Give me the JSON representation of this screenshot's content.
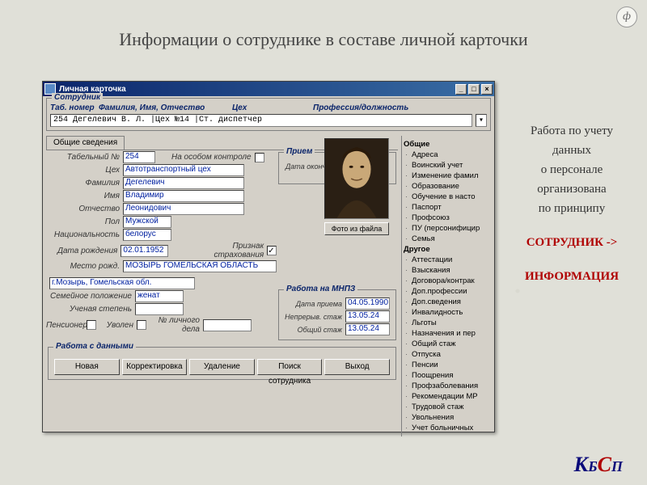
{
  "slide": {
    "title": "Информации о сотруднике в составе личной карточки",
    "side_lines": [
      "Работа по учету",
      "данных",
      "о персонале",
      "организована",
      "по принципу"
    ],
    "side_red1": "СОТРУДНИК ->",
    "side_red2": "ИНФОРМАЦИЯ",
    "brand_k": "К",
    "brand_b": "Б",
    "brand_c": "С",
    "brand_p": "П",
    "logo": "ф"
  },
  "win": {
    "title": "Личная карточка",
    "min": "_",
    "max": "□",
    "close": "×",
    "group_legend": "Сотрудник",
    "hdr_tab": "Таб. номер",
    "hdr_fio": "Фамилия, Имя, Отчество",
    "hdr_ceh": "Цех",
    "hdr_prof": "Профессия/должность",
    "hdr_line": "254    Дегелевич В. Л.          |Цех №14        |Ст. диспетчер",
    "dd": "▾",
    "tab_main": "Общие сведения",
    "lbl_tabno": "Табельный №",
    "val_tabno": "254",
    "lbl_special": "На особом контроле",
    "grp_priem": "Прием",
    "lbl_dataok": "Дата оконч. дог.",
    "lbl_ceh": "Цех",
    "val_ceh": "Автотранспортный цех",
    "lbl_fam": "Фамилия",
    "val_fam": "Дегелевич",
    "lbl_name": "Имя",
    "val_name": "Владимир",
    "lbl_otch": "Отчество",
    "val_otch": "Леонидович",
    "lbl_pol": "Пол",
    "val_pol": "Мужской",
    "lbl_nat": "Национальность",
    "val_nat": "белорус",
    "lbl_dob": "Дата рождения",
    "val_dob": "02.01.1952",
    "lbl_strah": "Признак страхования",
    "lbl_birthplace": "Место рожд.",
    "val_birthplace": "МОЗЫРЬ ГОМЕЛЬСКАЯ ОБЛАСТЬ",
    "val_addr": "г.Мозырь, Гомельская обл.",
    "lbl_family": "Семейное положение",
    "val_family": "женат",
    "lbl_degree": "Ученая степень",
    "lbl_pension": "Пенсионер",
    "lbl_fired": "Уволен",
    "lbl_delo": "№ личного дела",
    "photo_btn": "Фото из файла",
    "grp_mnpz": "Работа на МНПЗ",
    "lbl_hired": "Дата приема",
    "val_hired": "04.05.1990",
    "lbl_cont": "Непрерыв. стаж",
    "val_cont": "13.05.24",
    "lbl_total": "Общий стаж",
    "val_total": "13.05.24",
    "grp_actions": "Работа с данными",
    "btn_new": "Новая",
    "btn_edit": "Корректировка",
    "btn_del": "Удаление",
    "btn_find": "Поиск сотрудника",
    "btn_exit": "Выход"
  },
  "tree": {
    "root": "Общие",
    "items1": [
      "Адреса",
      "Воинский учет",
      "Изменение фамил",
      "Образование",
      "Обучение в насто",
      "Паспорт",
      "Профсоюз",
      "ПУ (персонифицир",
      "Семья"
    ],
    "root2": "Другое",
    "items2": [
      "Аттестации",
      "Взыскания",
      "Договора/контрак",
      "Доп.профессии",
      "Доп.сведения",
      "Инвалидность",
      "Льготы",
      "Назначения и пер",
      "Общий стаж",
      "Отпуска",
      "Пенсии",
      "Поощрения",
      "Профзаболевания",
      "Рекомендации МР",
      "Трудовой стаж",
      "Увольнения",
      "Учет больничных"
    ]
  }
}
